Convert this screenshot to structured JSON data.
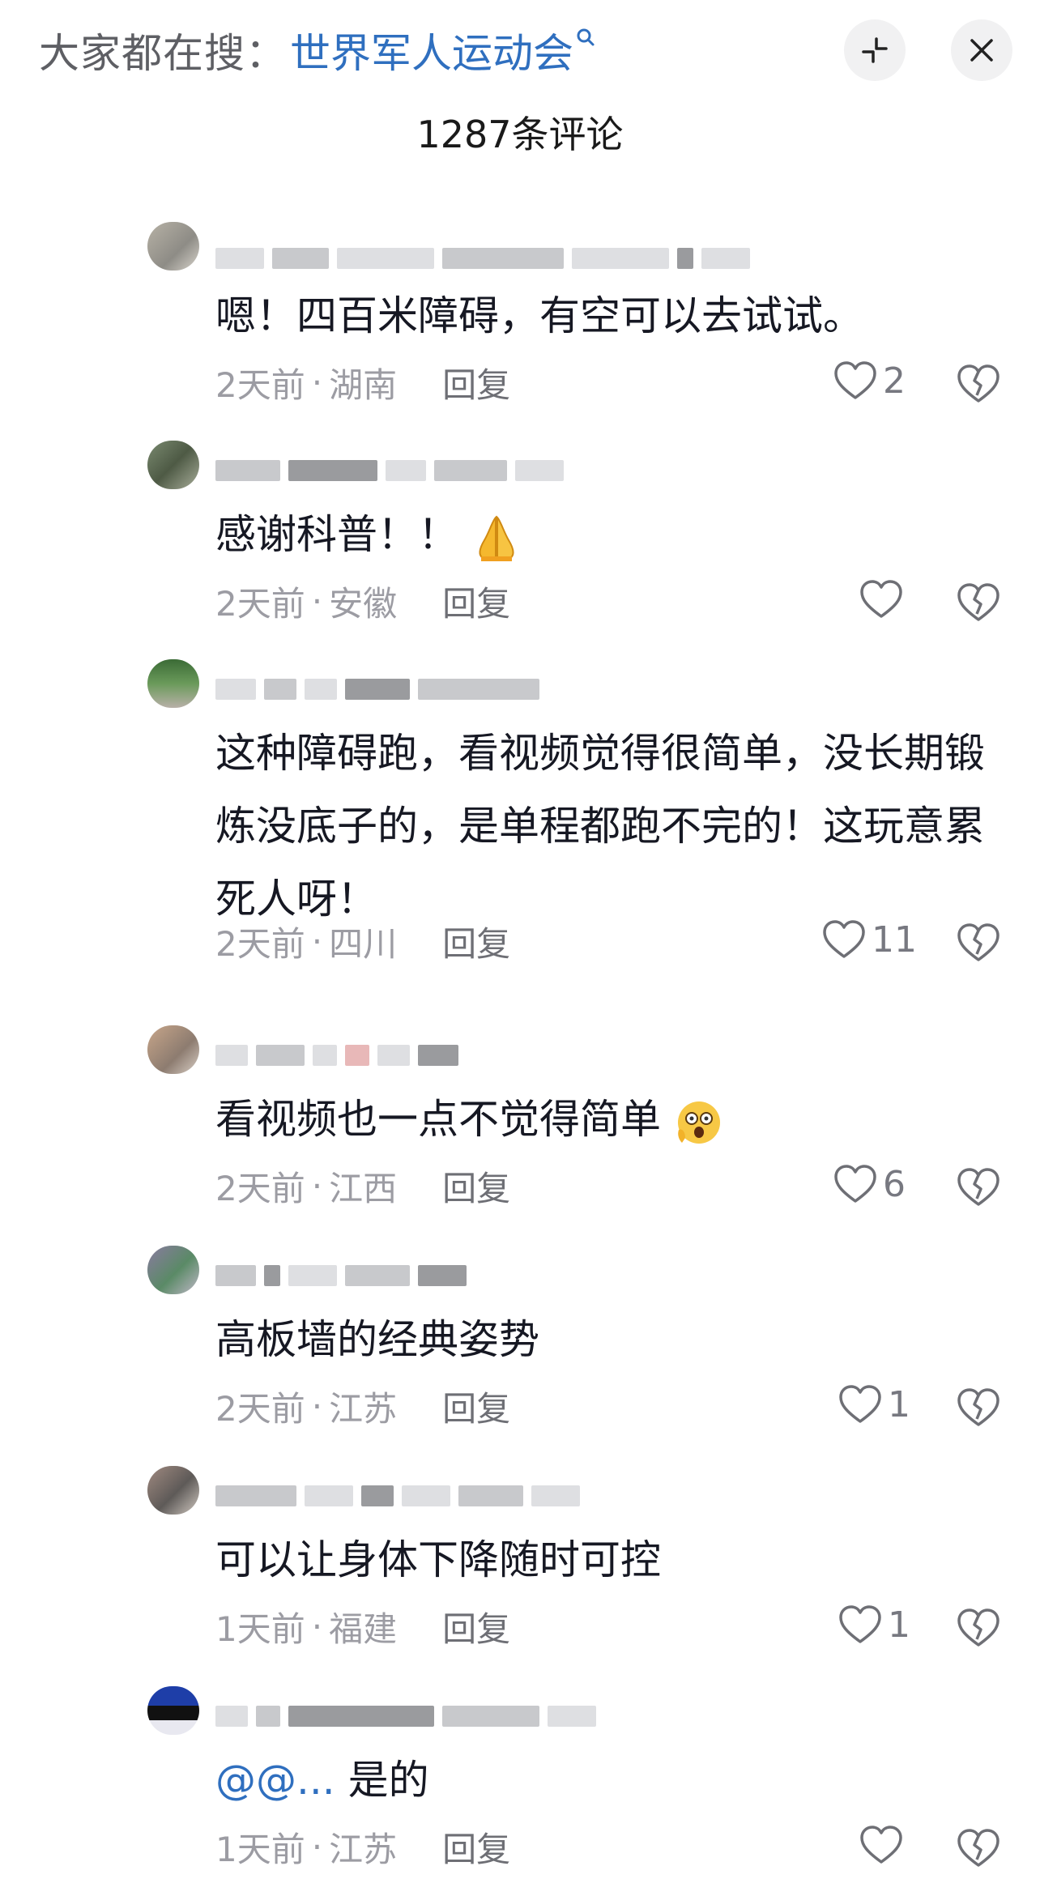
{
  "search": {
    "prefix": "大家都在搜：",
    "term": "世界军人运动会"
  },
  "header": {
    "title": "1287条评论"
  },
  "icons": {
    "search": "search-icon",
    "collapse": "collapse-icon",
    "close": "close-icon",
    "like": "heart-icon",
    "dislike": "broken-heart-icon"
  },
  "colors": {
    "link": "#2f6fbf",
    "meta": "#9c9ca3",
    "text": "#161823"
  },
  "comments": [
    {
      "text": "嗯！四百米障碍，有空可以去试试。",
      "time": "2天前",
      "location": "湖南",
      "reply": "回复",
      "likes": "2"
    },
    {
      "text": "感谢科普！！",
      "emoji": "folded-hands",
      "time": "2天前",
      "location": "安徽",
      "reply": "回复",
      "likes": ""
    },
    {
      "text": "这种障碍跑，看视频觉得很简单，没长期锻炼没底子的，是单程都跑不完的！这玩意累死人呀！",
      "time": "2天前",
      "location": "四川",
      "reply": "回复",
      "likes": "11"
    },
    {
      "text": "看视频也一点不觉得简单",
      "emoji": "shocked-face",
      "time": "2天前",
      "location": "江西",
      "reply": "回复",
      "likes": "6"
    },
    {
      "text": "高板墙的经典姿势",
      "time": "2天前",
      "location": "江苏",
      "reply": "回复",
      "likes": "1"
    },
    {
      "text": "可以让身体下降随时可控",
      "time": "1天前",
      "location": "福建",
      "reply": "回复",
      "likes": "1"
    },
    {
      "mention": "@@...",
      "text": " 是的",
      "time": "1天前",
      "location": "江苏",
      "reply": "回复",
      "likes": ""
    }
  ]
}
